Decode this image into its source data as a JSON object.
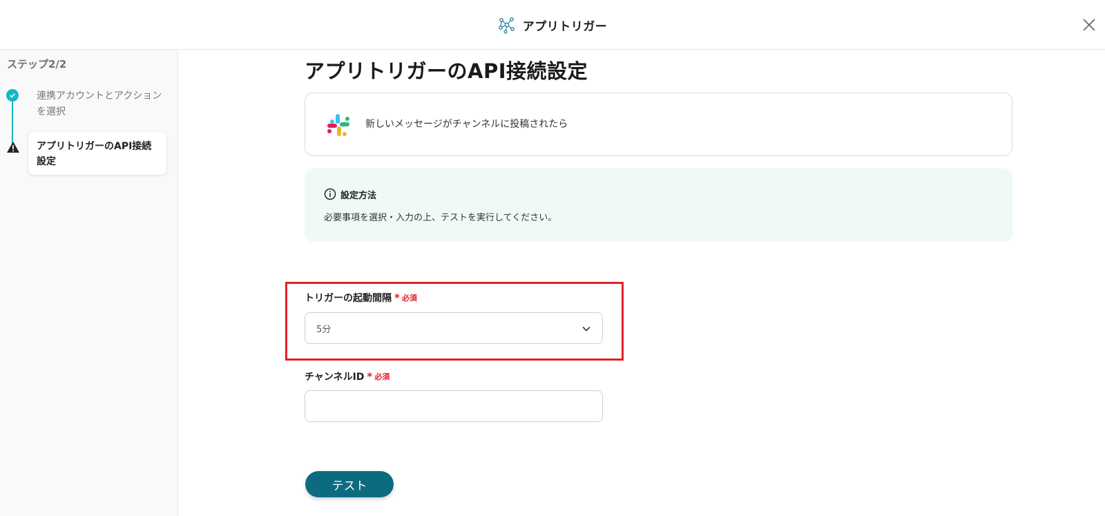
{
  "header": {
    "title": "アプリトリガー",
    "logo_icon": "network-nodes-icon",
    "close_icon": "close-icon"
  },
  "sidebar": {
    "step_label": "ステップ2/2",
    "steps": [
      {
        "label": "連携アカウントとアクションを選択",
        "status": "completed",
        "icon": "check-circle-icon"
      },
      {
        "label": "アプリトリガーのAPI接続設定",
        "status": "warning",
        "icon": "warning-icon"
      }
    ]
  },
  "main": {
    "title": "アプリトリガーのAPI接続設定",
    "trigger_card": {
      "app_icon": "slack-icon",
      "text": "新しいメッセージがチャンネルに投稿されたら"
    },
    "info": {
      "icon": "info-icon",
      "title": "設定方法",
      "description": "必要事項を選択・入力の上、テストを実行してください。"
    },
    "fields": {
      "interval": {
        "label": "トリガーの起動間隔",
        "required_mark": "*",
        "required_text": "必須",
        "value": "5分"
      },
      "channel_id": {
        "label": "チャンネルID",
        "required_mark": "*",
        "required_text": "必須",
        "value": "",
        "placeholder": ""
      }
    },
    "test_button": "テスト"
  },
  "colors": {
    "accent_teal": "#14b7c4",
    "button": "#0d6b80",
    "required": "#e3202a",
    "info_bg": "#f0f8f8"
  }
}
